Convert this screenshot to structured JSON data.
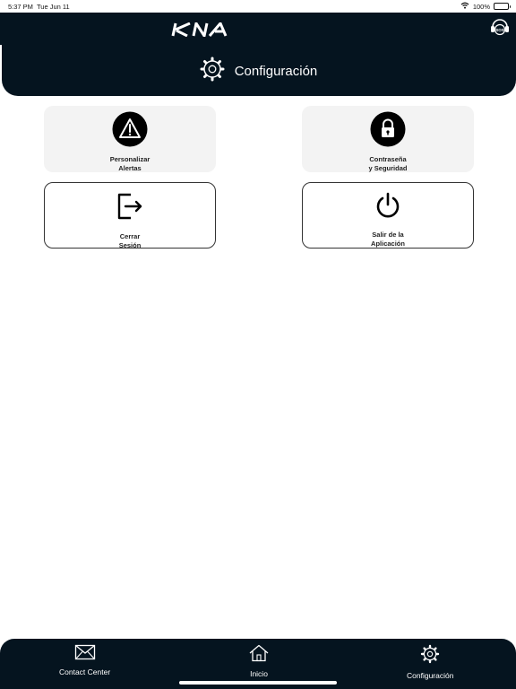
{
  "status_bar": {
    "time": "5:37 PM",
    "date": "Tue Jun 11",
    "battery": "100%",
    "battery_level": 1.0
  },
  "header": {
    "logo_text": "KIA",
    "title": "Configuración",
    "title_icon": "gear-icon",
    "sos_label": "SOS",
    "background": "#05141f"
  },
  "tiles": [
    {
      "line1": "Personalizar",
      "line2": "Alertas",
      "icon": "alert-triangle-icon",
      "style": "filled"
    },
    {
      "line1": "Contraseña",
      "line2": "y Seguridad",
      "icon": "lock-icon",
      "style": "filled"
    },
    {
      "line1": "Cerrar",
      "line2": "Sesión",
      "icon": "logout-icon",
      "style": "outlined"
    },
    {
      "line1": "Salir de la",
      "line2": "Aplicación",
      "icon": "power-icon",
      "style": "outlined"
    }
  ],
  "tab_bar": {
    "items": [
      {
        "label": "Contact Center",
        "icon": "mail-icon"
      },
      {
        "label": "Inicio",
        "icon": "home-icon"
      },
      {
        "label": "Configuración",
        "icon": "gear-icon"
      }
    ]
  }
}
